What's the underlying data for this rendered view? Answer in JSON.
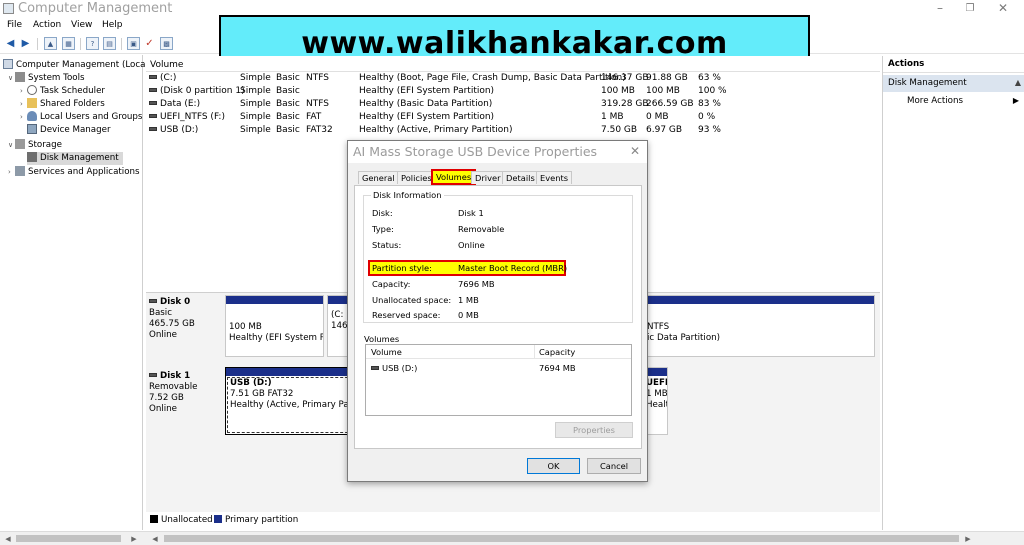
{
  "window": {
    "title": "Computer Management"
  },
  "menu": [
    "File",
    "Action",
    "View",
    "Help"
  ],
  "banner": {
    "text": "www.walikhankakar.com"
  },
  "tree": {
    "root": "Computer Management (Local",
    "system_tools": "System Tools",
    "task_scheduler": "Task Scheduler",
    "shared_folders": "Shared Folders",
    "local_users": "Local Users and Groups",
    "device_manager": "Device Manager",
    "storage": "Storage",
    "disk_management": "Disk Management",
    "services": "Services and Applications"
  },
  "volume_list": {
    "header": "Volume",
    "rows": [
      {
        "name": "(C:)",
        "layout": "Simple",
        "type": "Basic",
        "fs": "NTFS",
        "status": "Healthy (Boot, Page File, Crash Dump, Basic Data Partition)",
        "capacity": "146.37 GB",
        "free": "91.88 GB",
        "pct": "63 %"
      },
      {
        "name": "(Disk 0 partition 1)",
        "layout": "Simple",
        "type": "Basic",
        "fs": "",
        "status": "Healthy (EFI System Partition)",
        "capacity": "100 MB",
        "free": "100 MB",
        "pct": "100 %"
      },
      {
        "name": "Data (E:)",
        "layout": "Simple",
        "type": "Basic",
        "fs": "NTFS",
        "status": "Healthy (Basic Data Partition)",
        "capacity": "319.28 GB",
        "free": "266.59 GB",
        "pct": "83 %"
      },
      {
        "name": "UEFI_NTFS (F:)",
        "layout": "Simple",
        "type": "Basic",
        "fs": "FAT",
        "status": "Healthy (EFI System Partition)",
        "capacity": "1 MB",
        "free": "0 MB",
        "pct": "0 %"
      },
      {
        "name": "USB (D:)",
        "layout": "Simple",
        "type": "Basic",
        "fs": "FAT32",
        "status": "Healthy (Active, Primary Partition)",
        "capacity": "7.50 GB",
        "free": "6.97 GB",
        "pct": "93 %"
      }
    ]
  },
  "disks": {
    "disk0": {
      "name": "Disk 0",
      "kind": "Basic",
      "size": "465.75 GB",
      "state": "Online",
      "p1_size": "100 MB",
      "p1_status": "Healthy (EFI System Pa",
      "p2_name": "(C:",
      "p2_size": "146.",
      "p3_fs": "NTFS",
      "p3_status": "ic Data Partition)"
    },
    "disk1": {
      "name": "Disk 1",
      "kind": "Removable",
      "size": "7.52 GB",
      "state": "Online",
      "p1_name": "USB  (D:)",
      "p1_size": "7.51 GB FAT32",
      "p1_status": "Healthy (Active, Primary Partitio",
      "p2_name": "UEFI_",
      "p2_size": "1 MB",
      "p2_status": "Healt"
    }
  },
  "legend": {
    "unallocated": "Unallocated",
    "primary": "Primary partition"
  },
  "actions": {
    "title": "Actions",
    "section": "Disk Management",
    "more": "More Actions"
  },
  "dialog": {
    "title": "AI Mass Storage USB Device Properties",
    "tabs": [
      "General",
      "Policies",
      "Volumes",
      "Driver",
      "Details",
      "Events"
    ],
    "group_title": "Disk Information",
    "fields": [
      {
        "label": "Disk:",
        "value": "Disk 1"
      },
      {
        "label": "Type:",
        "value": "Removable"
      },
      {
        "label": "Status:",
        "value": "Online"
      },
      {
        "label": "Partition style:",
        "value": "Master Boot Record (MBR)"
      },
      {
        "label": "Capacity:",
        "value": "7696 MB"
      },
      {
        "label": "Unallocated space:",
        "value": "1 MB"
      },
      {
        "label": "Reserved space:",
        "value": "0 MB"
      }
    ],
    "volumes_label": "Volumes",
    "vol_col_volume": "Volume",
    "vol_col_capacity": "Capacity",
    "vol_row": {
      "name": "USB (D:)",
      "capacity": "7694 MB"
    },
    "properties_button": "Properties",
    "ok_button": "OK",
    "cancel_button": "Cancel"
  },
  "colors": {
    "accent": "#63ecfa",
    "highlight": "#ffff00",
    "outline": "#e00000",
    "primary_bar": "#1b2f8a"
  }
}
